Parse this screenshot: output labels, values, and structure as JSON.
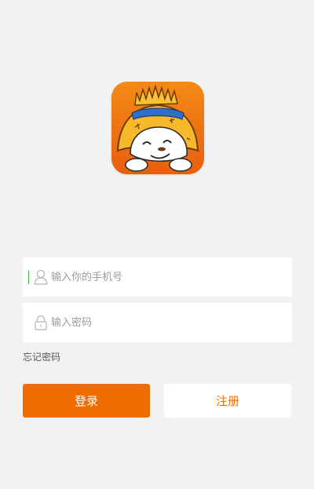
{
  "login_form": {
    "phone_placeholder": "输入你的手机号",
    "password_placeholder": "输入密码",
    "forgot_password": "忘记密码",
    "login_button": "登录",
    "register_button": "注册"
  },
  "icons": {
    "logo": "straw-hat-mascot-icon",
    "phone_field": "user-icon",
    "password_field": "lock-icon"
  },
  "colors": {
    "accent": "#ef6c00",
    "background": "#f2f2f2",
    "placeholder": "#9a9a9a"
  }
}
